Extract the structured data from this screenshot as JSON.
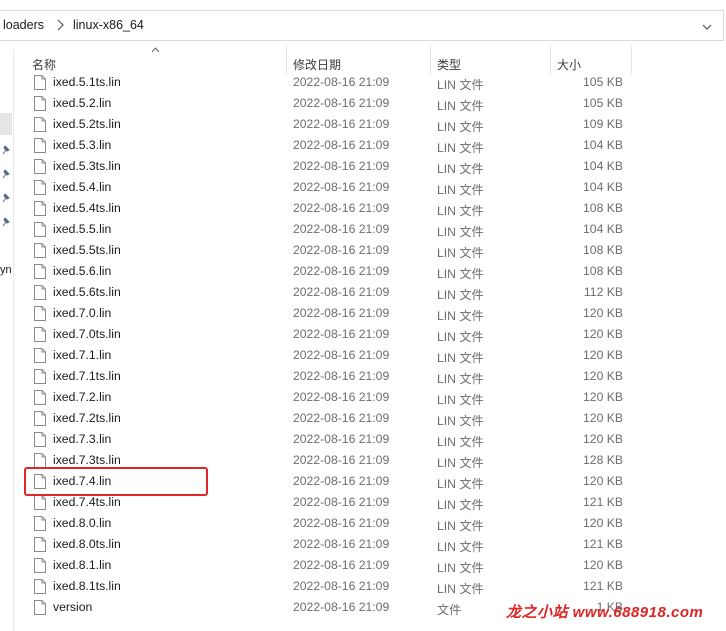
{
  "breadcrumb": {
    "parent": "loaders",
    "current": "linux-x86_64"
  },
  "nav": {
    "partial_label": "yn"
  },
  "columns": {
    "name": "名称",
    "date": "修改日期",
    "type": "类型",
    "size": "大小"
  },
  "files": [
    {
      "name": "ixed.5.1ts.lin",
      "date": "2022-08-16 21:09",
      "type": "LIN 文件",
      "size": "105 KB"
    },
    {
      "name": "ixed.5.2.lin",
      "date": "2022-08-16 21:09",
      "type": "LIN 文件",
      "size": "105 KB"
    },
    {
      "name": "ixed.5.2ts.lin",
      "date": "2022-08-16 21:09",
      "type": "LIN 文件",
      "size": "109 KB"
    },
    {
      "name": "ixed.5.3.lin",
      "date": "2022-08-16 21:09",
      "type": "LIN 文件",
      "size": "104 KB"
    },
    {
      "name": "ixed.5.3ts.lin",
      "date": "2022-08-16 21:09",
      "type": "LIN 文件",
      "size": "104 KB"
    },
    {
      "name": "ixed.5.4.lin",
      "date": "2022-08-16 21:09",
      "type": "LIN 文件",
      "size": "104 KB"
    },
    {
      "name": "ixed.5.4ts.lin",
      "date": "2022-08-16 21:09",
      "type": "LIN 文件",
      "size": "108 KB"
    },
    {
      "name": "ixed.5.5.lin",
      "date": "2022-08-16 21:09",
      "type": "LIN 文件",
      "size": "104 KB"
    },
    {
      "name": "ixed.5.5ts.lin",
      "date": "2022-08-16 21:09",
      "type": "LIN 文件",
      "size": "108 KB"
    },
    {
      "name": "ixed.5.6.lin",
      "date": "2022-08-16 21:09",
      "type": "LIN 文件",
      "size": "108 KB"
    },
    {
      "name": "ixed.5.6ts.lin",
      "date": "2022-08-16 21:09",
      "type": "LIN 文件",
      "size": "112 KB"
    },
    {
      "name": "ixed.7.0.lin",
      "date": "2022-08-16 21:09",
      "type": "LIN 文件",
      "size": "120 KB"
    },
    {
      "name": "ixed.7.0ts.lin",
      "date": "2022-08-16 21:09",
      "type": "LIN 文件",
      "size": "120 KB"
    },
    {
      "name": "ixed.7.1.lin",
      "date": "2022-08-16 21:09",
      "type": "LIN 文件",
      "size": "120 KB"
    },
    {
      "name": "ixed.7.1ts.lin",
      "date": "2022-08-16 21:09",
      "type": "LIN 文件",
      "size": "120 KB"
    },
    {
      "name": "ixed.7.2.lin",
      "date": "2022-08-16 21:09",
      "type": "LIN 文件",
      "size": "120 KB"
    },
    {
      "name": "ixed.7.2ts.lin",
      "date": "2022-08-16 21:09",
      "type": "LIN 文件",
      "size": "120 KB"
    },
    {
      "name": "ixed.7.3.lin",
      "date": "2022-08-16 21:09",
      "type": "LIN 文件",
      "size": "120 KB"
    },
    {
      "name": "ixed.7.3ts.lin",
      "date": "2022-08-16 21:09",
      "type": "LIN 文件",
      "size": "128 KB"
    },
    {
      "name": "ixed.7.4.lin",
      "date": "2022-08-16 21:09",
      "type": "LIN 文件",
      "size": "120 KB"
    },
    {
      "name": "ixed.7.4ts.lin",
      "date": "2022-08-16 21:09",
      "type": "LIN 文件",
      "size": "121 KB"
    },
    {
      "name": "ixed.8.0.lin",
      "date": "2022-08-16 21:09",
      "type": "LIN 文件",
      "size": "120 KB"
    },
    {
      "name": "ixed.8.0ts.lin",
      "date": "2022-08-16 21:09",
      "type": "LIN 文件",
      "size": "121 KB"
    },
    {
      "name": "ixed.8.1.lin",
      "date": "2022-08-16 21:09",
      "type": "LIN 文件",
      "size": "120 KB"
    },
    {
      "name": "ixed.8.1ts.lin",
      "date": "2022-08-16 21:09",
      "type": "LIN 文件",
      "size": "121 KB"
    },
    {
      "name": "version",
      "date": "2022-08-16 21:09",
      "type": "文件",
      "size": "1 KB"
    }
  ],
  "highlighted_file": "ixed.7.4.lin",
  "watermark": "龙之小站 www.688918.com",
  "colors": {
    "highlight_border": "#e0282b",
    "watermark": "#e02424"
  }
}
